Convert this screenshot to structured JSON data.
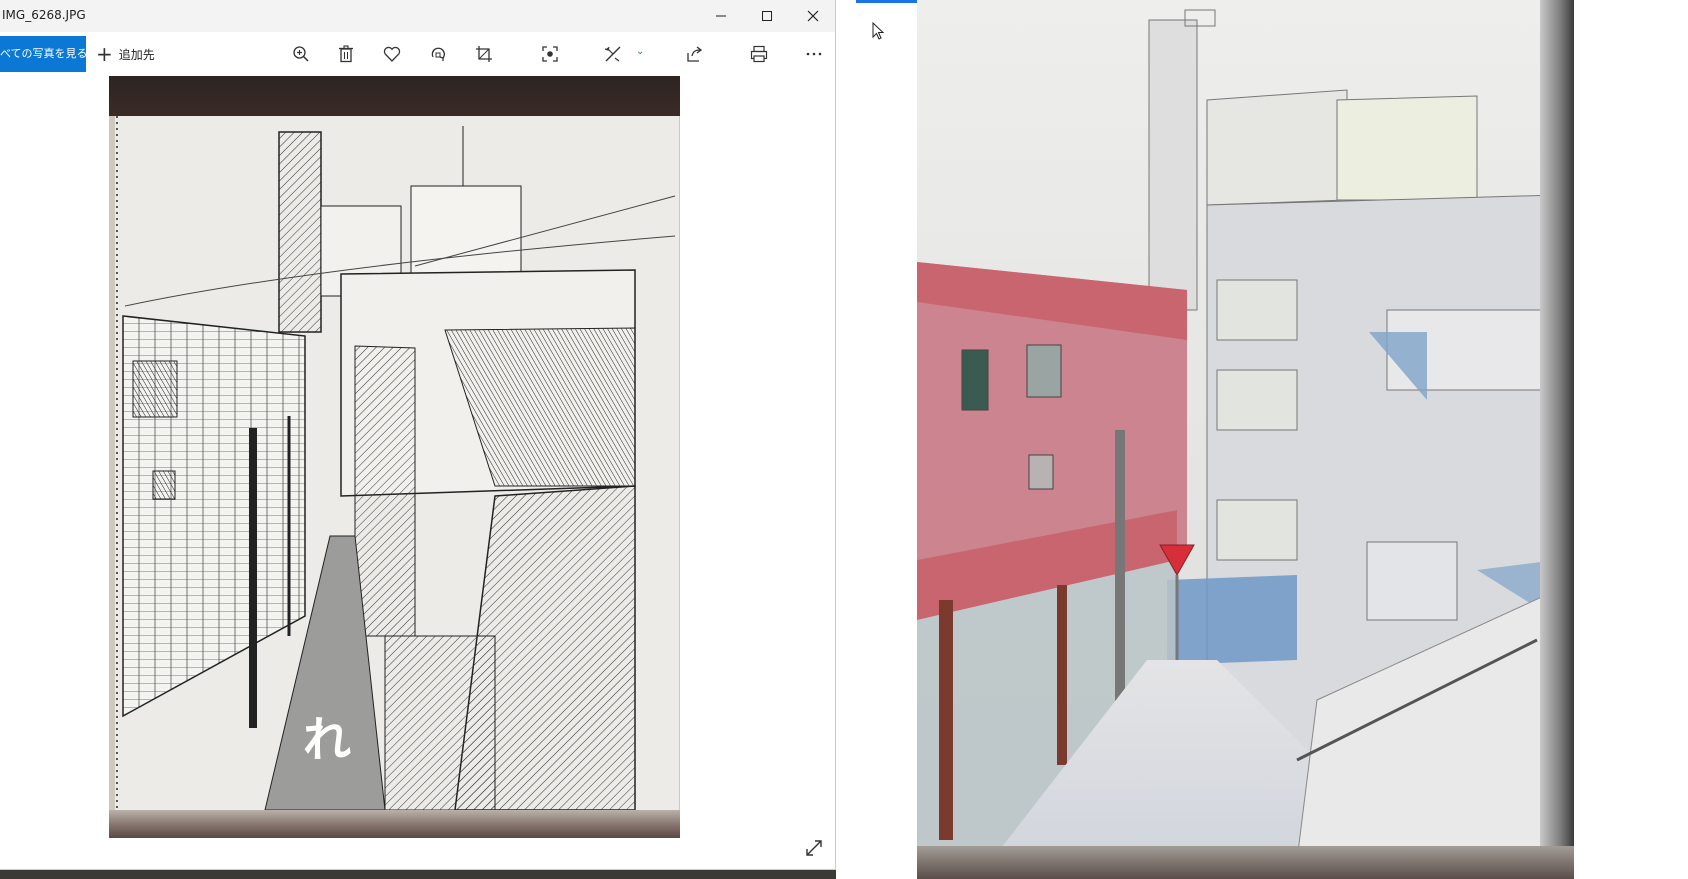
{
  "window": {
    "title": "IMG_6268.JPG",
    "controls": [
      "minimize",
      "maximize",
      "close"
    ]
  },
  "toolbar": {
    "see_all_label": "べての写真を見る",
    "add_label": "追加先",
    "icons": [
      "zoom-in-icon",
      "delete-icon",
      "favorite-icon",
      "rotate-icon",
      "crop-icon",
      "visual-search-icon",
      "edit-icon",
      "share-icon",
      "print-icon",
      "more-icon"
    ],
    "accent": "#0a78d4"
  },
  "photo": {
    "left_description_colors": {
      "paper": "#ecebe7",
      "ink": "#222222"
    },
    "road_text": "れ"
  },
  "colors": {
    "titlebar": "#f3f3f3",
    "window_bg": "#ffffff",
    "pink_building": "#c97a86",
    "sky": "#e9e9e8",
    "blue_shade": "#7fa3c9",
    "yield_sign": "#d62f3a"
  }
}
